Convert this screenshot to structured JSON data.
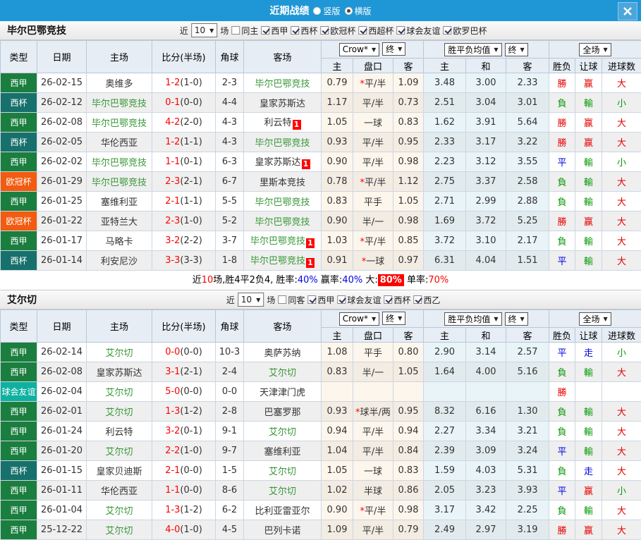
{
  "titlebar": {
    "title": "近期战绩",
    "vertical_label": "竖版",
    "horizontal_label": "横版",
    "vertical_selected": false,
    "horizontal_selected": true
  },
  "colors": {
    "liga": "#1a7e3e",
    "cup": "#17706b",
    "ucl": "#f25b10",
    "friendly": "#10b0a1",
    "titlebar_blue": "#1f96d5",
    "team_green": "#389738",
    "r": "#e60000",
    "g": "#0a9a0a",
    "b": "#0000e6"
  },
  "table_header": {
    "main_cols": [
      "类型",
      "日期",
      "主场",
      "比分(半场)",
      "角球",
      "客场"
    ],
    "odds_company_select": "Crow*",
    "odds_final_select": "终",
    "mean_select": "胜平负均值",
    "mean_final_select": "终",
    "scope_select": "全场",
    "odds_sub": [
      "主",
      "盘口",
      "客"
    ],
    "mean_sub": [
      "主",
      "和",
      "客"
    ],
    "result_sub": [
      "胜负",
      "让球",
      "进球数"
    ]
  },
  "sections": [
    {
      "team": "毕尔巴鄂竞技",
      "filter": {
        "near": "近",
        "count": "10",
        "games": "场",
        "same": {
          "label": "同主",
          "checked": false
        },
        "leagues": [
          {
            "label": "西甲",
            "checked": true
          },
          {
            "label": "西杯",
            "checked": true
          },
          {
            "label": "欧冠杯",
            "checked": true
          },
          {
            "label": "西超杯",
            "checked": true
          },
          {
            "label": "球会友谊",
            "checked": true
          },
          {
            "label": "欧罗巴杯",
            "checked": true
          }
        ]
      },
      "rows": [
        {
          "type": "西甲",
          "type_key": "liga",
          "date": "26-02-15",
          "home": "奥维多",
          "home_green": false,
          "home_badge": "",
          "score": "1-2",
          "half": "(1-0)",
          "corners": "2-3",
          "away": "毕尔巴鄂竞技",
          "away_green": true,
          "away_badge": "",
          "odds": [
            "0.79",
            "*平/半",
            "1.09"
          ],
          "mean": [
            "3.48",
            "3.00",
            "2.33"
          ],
          "results": [
            [
              "勝",
              "r"
            ],
            [
              "赢",
              "r"
            ],
            [
              "大",
              "r"
            ]
          ]
        },
        {
          "type": "西杯",
          "type_key": "cup",
          "date": "26-02-12",
          "home": "毕尔巴鄂竞技",
          "home_green": true,
          "home_badge": "",
          "score": "0-1",
          "half": "(0-0)",
          "corners": "4-4",
          "away": "皇家苏斯达",
          "away_green": false,
          "away_badge": "",
          "odds": [
            "1.17",
            "平/半",
            "0.73"
          ],
          "mean": [
            "2.51",
            "3.04",
            "3.01"
          ],
          "results": [
            [
              "負",
              "g"
            ],
            [
              "輸",
              "g"
            ],
            [
              "小",
              "g"
            ]
          ]
        },
        {
          "type": "西甲",
          "type_key": "liga",
          "date": "26-02-08",
          "home": "毕尔巴鄂竞技",
          "home_green": true,
          "home_badge": "",
          "score": "4-2",
          "half": "(2-0)",
          "corners": "4-3",
          "away": "利云特",
          "away_green": false,
          "away_badge": "1",
          "odds": [
            "1.05",
            "一球",
            "0.83"
          ],
          "mean": [
            "1.62",
            "3.91",
            "5.64"
          ],
          "results": [
            [
              "勝",
              "r"
            ],
            [
              "赢",
              "r"
            ],
            [
              "大",
              "r"
            ]
          ]
        },
        {
          "type": "西杯",
          "type_key": "cup",
          "date": "26-02-05",
          "home": "华伦西亚",
          "home_green": false,
          "home_badge": "",
          "score": "1-2",
          "half": "(1-1)",
          "corners": "4-3",
          "away": "毕尔巴鄂竞技",
          "away_green": true,
          "away_badge": "",
          "odds": [
            "0.93",
            "平/半",
            "0.95"
          ],
          "mean": [
            "2.33",
            "3.17",
            "3.22"
          ],
          "results": [
            [
              "勝",
              "r"
            ],
            [
              "赢",
              "r"
            ],
            [
              "大",
              "r"
            ]
          ]
        },
        {
          "type": "西甲",
          "type_key": "liga",
          "date": "26-02-02",
          "home": "毕尔巴鄂竞技",
          "home_green": true,
          "home_badge": "",
          "score": "1-1",
          "half": "(0-1)",
          "corners": "6-3",
          "away": "皇家苏斯达",
          "away_green": false,
          "away_badge": "1",
          "odds": [
            "0.90",
            "平/半",
            "0.98"
          ],
          "mean": [
            "2.23",
            "3.12",
            "3.55"
          ],
          "results": [
            [
              "平",
              "b"
            ],
            [
              "輸",
              "g"
            ],
            [
              "小",
              "g"
            ]
          ]
        },
        {
          "type": "欧冠杯",
          "type_key": "ucl",
          "date": "26-01-29",
          "home": "毕尔巴鄂竞技",
          "home_green": true,
          "home_badge": "",
          "score": "2-3",
          "half": "(2-1)",
          "corners": "6-7",
          "away": "里斯本竞技",
          "away_green": false,
          "away_badge": "",
          "odds": [
            "0.78",
            "*平/半",
            "1.12"
          ],
          "mean": [
            "2.75",
            "3.37",
            "2.58"
          ],
          "results": [
            [
              "負",
              "g"
            ],
            [
              "輸",
              "g"
            ],
            [
              "大",
              "r"
            ]
          ]
        },
        {
          "type": "西甲",
          "type_key": "liga",
          "date": "26-01-25",
          "home": "塞维利亚",
          "home_green": false,
          "home_badge": "",
          "score": "2-1",
          "half": "(1-1)",
          "corners": "5-5",
          "away": "毕尔巴鄂竞技",
          "away_green": true,
          "away_badge": "",
          "odds": [
            "0.83",
            "平手",
            "1.05"
          ],
          "mean": [
            "2.71",
            "2.99",
            "2.88"
          ],
          "results": [
            [
              "負",
              "g"
            ],
            [
              "輸",
              "g"
            ],
            [
              "大",
              "r"
            ]
          ]
        },
        {
          "type": "欧冠杯",
          "type_key": "ucl",
          "date": "26-01-22",
          "home": "亚特兰大",
          "home_green": false,
          "home_badge": "",
          "score": "2-3",
          "half": "(1-0)",
          "corners": "5-2",
          "away": "毕尔巴鄂竞技",
          "away_green": true,
          "away_badge": "",
          "odds": [
            "0.90",
            "半/一",
            "0.98"
          ],
          "mean": [
            "1.69",
            "3.72",
            "5.25"
          ],
          "results": [
            [
              "勝",
              "r"
            ],
            [
              "赢",
              "r"
            ],
            [
              "大",
              "r"
            ]
          ]
        },
        {
          "type": "西甲",
          "type_key": "liga",
          "date": "26-01-17",
          "home": "马略卡",
          "home_green": false,
          "home_badge": "",
          "score": "3-2",
          "half": "(2-2)",
          "corners": "3-7",
          "away": "毕尔巴鄂竞技",
          "away_green": true,
          "away_badge": "1",
          "odds": [
            "1.03",
            "*平/半",
            "0.85"
          ],
          "mean": [
            "3.72",
            "3.10",
            "2.17"
          ],
          "results": [
            [
              "負",
              "g"
            ],
            [
              "輸",
              "g"
            ],
            [
              "大",
              "r"
            ]
          ]
        },
        {
          "type": "西杯",
          "type_key": "cup",
          "date": "26-01-14",
          "home": "利安尼沙",
          "home_green": false,
          "home_badge": "",
          "score": "3-3",
          "half": "(3-3)",
          "corners": "1-8",
          "away": "毕尔巴鄂竞技",
          "away_green": true,
          "away_badge": "1",
          "odds": [
            "0.91",
            "*一球",
            "0.97"
          ],
          "mean": [
            "6.31",
            "4.04",
            "1.51"
          ],
          "results": [
            [
              "平",
              "b"
            ],
            [
              "輸",
              "g"
            ],
            [
              "大",
              "r"
            ]
          ]
        }
      ],
      "summary": {
        "parts": [
          {
            "text": "近",
            "style": "k"
          },
          {
            "text": "10",
            "style": "r"
          },
          {
            "text": "场,胜4平2负4, 胜率:",
            "style": "k"
          },
          {
            "text": "40%",
            "style": "b"
          },
          {
            "text": " 赢率:",
            "style": "k"
          },
          {
            "text": "40%",
            "style": "b"
          },
          {
            "text": " 大:",
            "style": "k"
          },
          {
            "text": "80%",
            "style": "hl"
          },
          {
            "text": " 单率:",
            "style": "k"
          },
          {
            "text": "70%",
            "style": "r"
          }
        ]
      }
    },
    {
      "team": "艾尔切",
      "filter": {
        "near": "近",
        "count": "10",
        "games": "场",
        "same": {
          "label": "同客",
          "checked": false
        },
        "leagues": [
          {
            "label": "西甲",
            "checked": true
          },
          {
            "label": "球会友谊",
            "checked": true
          },
          {
            "label": "西杯",
            "checked": true
          },
          {
            "label": "西乙",
            "checked": true
          }
        ]
      },
      "rows": [
        {
          "type": "西甲",
          "type_key": "liga",
          "date": "26-02-14",
          "home": "艾尔切",
          "home_green": true,
          "home_badge": "",
          "score": "0-0",
          "half": "(0-0)",
          "corners": "10-3",
          "away": "奥萨苏纳",
          "away_green": false,
          "away_badge": "",
          "odds": [
            "1.08",
            "平手",
            "0.80"
          ],
          "mean": [
            "2.90",
            "3.14",
            "2.57"
          ],
          "results": [
            [
              "平",
              "b"
            ],
            [
              "走",
              "b"
            ],
            [
              "小",
              "g"
            ]
          ]
        },
        {
          "type": "西甲",
          "type_key": "liga",
          "date": "26-02-08",
          "home": "皇家苏斯达",
          "home_green": false,
          "home_badge": "",
          "score": "3-1",
          "half": "(2-1)",
          "corners": "2-4",
          "away": "艾尔切",
          "away_green": true,
          "away_badge": "",
          "odds": [
            "0.83",
            "半/一",
            "1.05"
          ],
          "mean": [
            "1.64",
            "4.00",
            "5.16"
          ],
          "results": [
            [
              "負",
              "g"
            ],
            [
              "輸",
              "g"
            ],
            [
              "大",
              "r"
            ]
          ]
        },
        {
          "type": "球会友谊",
          "type_key": "friendly",
          "date": "26-02-04",
          "home": "艾尔切",
          "home_green": true,
          "home_badge": "",
          "score": "5-0",
          "half": "(0-0)",
          "corners": "0-0",
          "away": "天津津门虎",
          "away_green": false,
          "away_badge": "",
          "odds": [
            "",
            "",
            ""
          ],
          "mean": [
            "",
            "",
            ""
          ],
          "results": [
            [
              "勝",
              "r"
            ],
            [
              "",
              ""
            ],
            [
              "",
              ""
            ]
          ]
        },
        {
          "type": "西甲",
          "type_key": "liga",
          "date": "26-02-01",
          "home": "艾尔切",
          "home_green": true,
          "home_badge": "",
          "score": "1-3",
          "half": "(1-2)",
          "corners": "2-8",
          "away": "巴塞罗那",
          "away_green": false,
          "away_badge": "",
          "odds": [
            "0.93",
            "*球半/两",
            "0.95"
          ],
          "mean": [
            "8.32",
            "6.16",
            "1.30"
          ],
          "results": [
            [
              "負",
              "g"
            ],
            [
              "輸",
              "g"
            ],
            [
              "大",
              "r"
            ]
          ]
        },
        {
          "type": "西甲",
          "type_key": "liga",
          "date": "26-01-24",
          "home": "利云特",
          "home_green": false,
          "home_badge": "",
          "score": "3-2",
          "half": "(0-1)",
          "corners": "9-1",
          "away": "艾尔切",
          "away_green": true,
          "away_badge": "",
          "odds": [
            "0.94",
            "平/半",
            "0.94"
          ],
          "mean": [
            "2.27",
            "3.34",
            "3.21"
          ],
          "results": [
            [
              "負",
              "g"
            ],
            [
              "輸",
              "g"
            ],
            [
              "大",
              "r"
            ]
          ]
        },
        {
          "type": "西甲",
          "type_key": "liga",
          "date": "26-01-20",
          "home": "艾尔切",
          "home_green": true,
          "home_badge": "",
          "score": "2-2",
          "half": "(1-0)",
          "corners": "9-7",
          "away": "塞维利亚",
          "away_green": false,
          "away_badge": "",
          "odds": [
            "1.04",
            "平/半",
            "0.84"
          ],
          "mean": [
            "2.39",
            "3.09",
            "3.24"
          ],
          "results": [
            [
              "平",
              "b"
            ],
            [
              "輸",
              "g"
            ],
            [
              "大",
              "r"
            ]
          ]
        },
        {
          "type": "西杯",
          "type_key": "cup",
          "date": "26-01-15",
          "home": "皇家贝迪斯",
          "home_green": false,
          "home_badge": "",
          "score": "2-1",
          "half": "(0-0)",
          "corners": "1-5",
          "away": "艾尔切",
          "away_green": true,
          "away_badge": "",
          "odds": [
            "1.05",
            "一球",
            "0.83"
          ],
          "mean": [
            "1.59",
            "4.03",
            "5.31"
          ],
          "results": [
            [
              "負",
              "g"
            ],
            [
              "走",
              "b"
            ],
            [
              "大",
              "r"
            ]
          ]
        },
        {
          "type": "西甲",
          "type_key": "liga",
          "date": "26-01-11",
          "home": "华伦西亚",
          "home_green": false,
          "home_badge": "",
          "score": "1-1",
          "half": "(0-0)",
          "corners": "8-6",
          "away": "艾尔切",
          "away_green": true,
          "away_badge": "",
          "odds": [
            "1.02",
            "半球",
            "0.86"
          ],
          "mean": [
            "2.05",
            "3.23",
            "3.93"
          ],
          "results": [
            [
              "平",
              "b"
            ],
            [
              "赢",
              "r"
            ],
            [
              "小",
              "g"
            ]
          ]
        },
        {
          "type": "西甲",
          "type_key": "liga",
          "date": "26-01-04",
          "home": "艾尔切",
          "home_green": true,
          "home_badge": "",
          "score": "1-3",
          "half": "(1-2)",
          "corners": "6-2",
          "away": "比利亚雷亚尔",
          "away_green": false,
          "away_badge": "",
          "odds": [
            "0.90",
            "*平/半",
            "0.98"
          ],
          "mean": [
            "3.17",
            "3.42",
            "2.25"
          ],
          "results": [
            [
              "負",
              "g"
            ],
            [
              "輸",
              "g"
            ],
            [
              "大",
              "r"
            ]
          ]
        },
        {
          "type": "西甲",
          "type_key": "liga",
          "date": "25-12-22",
          "home": "艾尔切",
          "home_green": true,
          "home_badge": "",
          "score": "4-0",
          "half": "(1-0)",
          "corners": "4-5",
          "away": "巴列卡诺",
          "away_green": false,
          "away_badge": "",
          "odds": [
            "1.09",
            "平/半",
            "0.79"
          ],
          "mean": [
            "2.49",
            "2.97",
            "3.19"
          ],
          "results": [
            [
              "勝",
              "r"
            ],
            [
              "赢",
              "r"
            ],
            [
              "大",
              "r"
            ]
          ]
        }
      ]
    }
  ]
}
